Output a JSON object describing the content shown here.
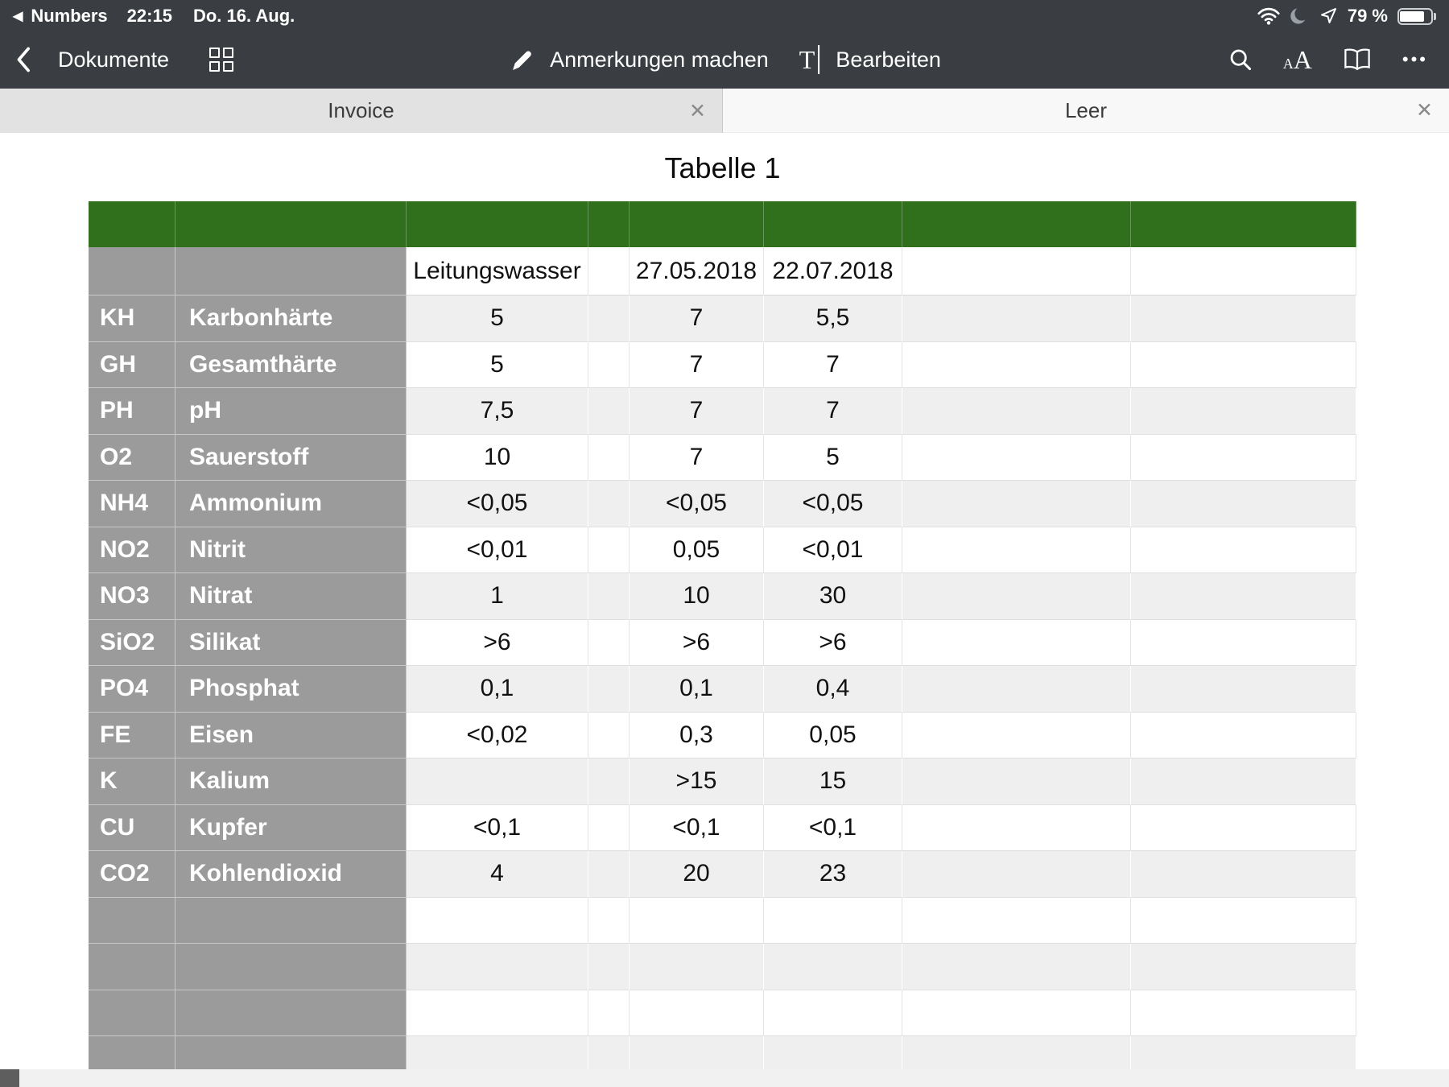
{
  "status_bar": {
    "back_app_indicator": "◀",
    "app_name": "Numbers",
    "time": "22:15",
    "date": "Do. 16. Aug.",
    "battery_percent": "79 %",
    "icons": [
      "wifi-icon",
      "moon-icon",
      "location-icon",
      "battery-icon"
    ]
  },
  "toolbar": {
    "back_label": "Dokumente",
    "annotate_label": "Anmerkungen machen",
    "edit_label": "Bearbeiten",
    "icons": [
      "back-chevron-icon",
      "grid-icon",
      "pencil-icon",
      "text-cursor-icon",
      "search-icon",
      "text-size-icon",
      "book-icon",
      "more-icon"
    ]
  },
  "tabs": [
    {
      "label": "Invoice",
      "active": false
    },
    {
      "label": "Leer",
      "active": true
    }
  ],
  "icons": {
    "close_glyph": "✕",
    "more_glyph": "•••",
    "text_cursor_glyph": "T",
    "font_small_glyph": "A",
    "font_large_glyph": "A"
  },
  "document": {
    "title": "Tabelle 1"
  },
  "table": {
    "header": {
      "col3": "Leitungswasser",
      "col5": "27.05.2018",
      "col6": "22.07.2018"
    },
    "rows": [
      {
        "code": "KH",
        "name": "Karbonhärte",
        "v1": "5",
        "v2": "7",
        "v3": "5,5"
      },
      {
        "code": "GH",
        "name": "Gesamthärte",
        "v1": "5",
        "v2": "7",
        "v3": "7"
      },
      {
        "code": "PH",
        "name": "pH",
        "v1": "7,5",
        "v2": "7",
        "v3": "7"
      },
      {
        "code": "O2",
        "name": "Sauerstoff",
        "v1": "10",
        "v2": "7",
        "v3": "5"
      },
      {
        "code": "NH4",
        "name": "Ammonium",
        "v1": "<0,05",
        "v2": "<0,05",
        "v3": "<0,05"
      },
      {
        "code": "NO2",
        "name": "Nitrit",
        "v1": "<0,01",
        "v2": "0,05",
        "v3": "<0,01"
      },
      {
        "code": "NO3",
        "name": "Nitrat",
        "v1": "1",
        "v2": "10",
        "v3": "30"
      },
      {
        "code": "SiO2",
        "name": "Silikat",
        "v1": ">6",
        "v2": ">6",
        "v3": ">6"
      },
      {
        "code": "PO4",
        "name": "Phosphat",
        "v1": "0,1",
        "v2": "0,1",
        "v3": "0,4"
      },
      {
        "code": "FE",
        "name": "Eisen",
        "v1": "<0,02",
        "v2": "0,3",
        "v3": "0,05"
      },
      {
        "code": "K",
        "name": "Kalium",
        "v1": "",
        "v2": ">15",
        "v3": "15"
      },
      {
        "code": "CU",
        "name": "Kupfer",
        "v1": "<0,1",
        "v2": "<0,1",
        "v3": "<0,1"
      },
      {
        "code": "CO2",
        "name": "Kohlendioxid",
        "v1": "4",
        "v2": "20",
        "v3": "23"
      }
    ],
    "empty_row_count": 4
  },
  "colors": {
    "chrome_dark": "#3A3E43",
    "table_header_green": "#30701D",
    "row_header_gray": "#9B9B9B",
    "stripe_gray": "#EFEFEF",
    "tab_inactive": "#E2E2E2",
    "tab_active": "#F8F8F8"
  }
}
